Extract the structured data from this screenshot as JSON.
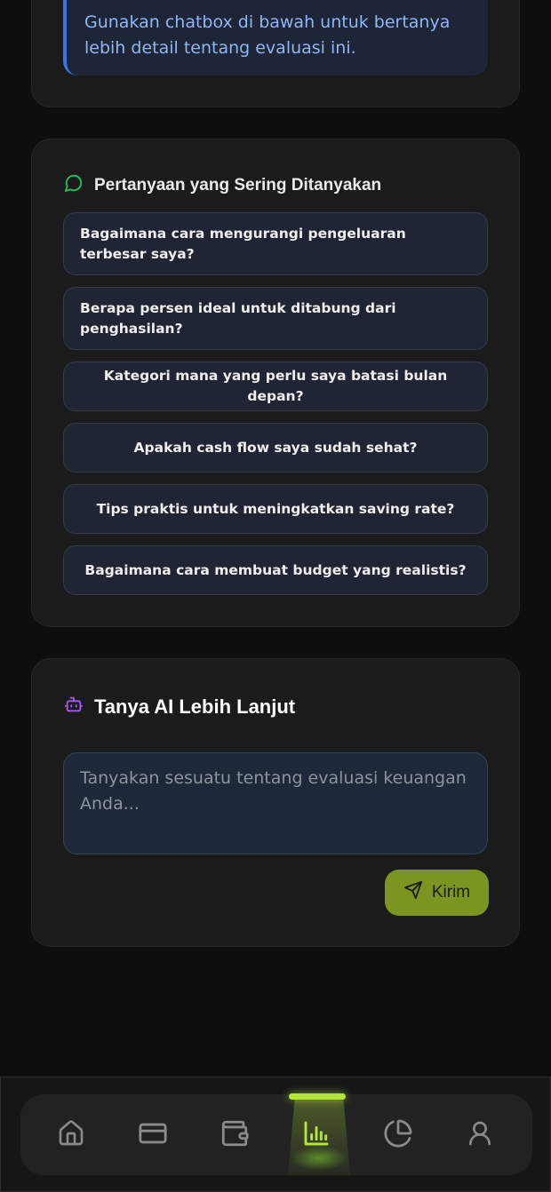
{
  "info": {
    "text": "Gunakan chatbox di bawah untuk bertanya lebih detail tentang evaluasi ini."
  },
  "faq": {
    "title": "Pertanyaan yang Sering Ditanyakan",
    "icon": "message-circle-icon",
    "questions": [
      "Bagaimana cara mengurangi pengeluaran terbesar saya?",
      "Berapa persen ideal untuk ditabung dari penghasilan?",
      "Kategori mana yang perlu saya batasi bulan depan?",
      "Apakah cash flow saya sudah sehat?",
      "Tips praktis untuk meningkatkan saving rate?",
      "Bagaimana cara membuat budget yang realistis?"
    ]
  },
  "ai": {
    "title": "Tanya AI Lebih Lanjut",
    "icon": "bot-icon",
    "input_value": "",
    "input_placeholder": "Tanyakan sesuatu tentang evaluasi keuangan Anda...",
    "send_label": "Kirim"
  },
  "nav": {
    "items": [
      "home-icon",
      "credit-card-icon",
      "wallet-icon",
      "bar-chart-icon",
      "pie-chart-icon",
      "user-icon"
    ],
    "active": "bar-chart-icon"
  },
  "colors": {
    "accent_green": "#b4e63a",
    "send_button": "#7b9620",
    "info_text": "#8fb6f5",
    "info_border": "#3b74e8",
    "faq_icon": "#22c55e",
    "bot_icon": "#a855f7"
  }
}
